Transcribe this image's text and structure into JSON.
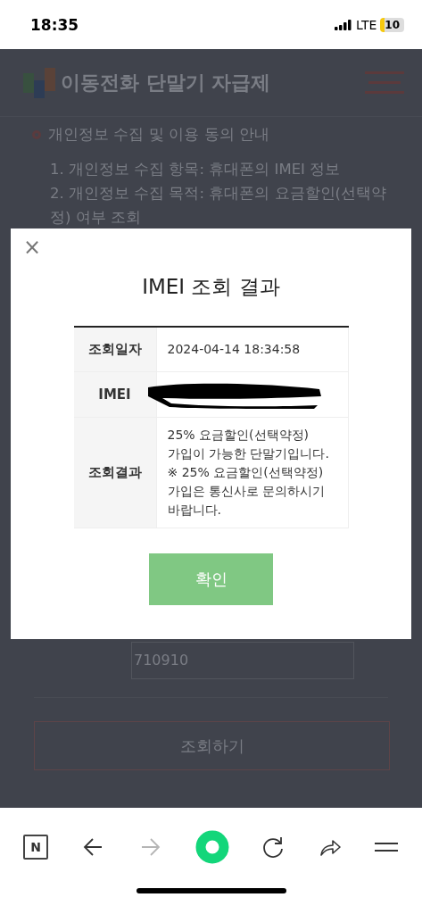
{
  "status_bar": {
    "time": "18:35",
    "network": "LTE",
    "battery": "10"
  },
  "page": {
    "site_title": "이동전화 단말기 자급제",
    "notice_heading": "개인정보 수집 및 이용 동의 안내",
    "notice_lines": [
      "1. 개인정보 수집 항목: 휴대폰의 IMEI 정보",
      "2. 개인정보 수집 목적: 휴대폰의 요금할인(선택약정) 여부 조회"
    ],
    "birth_field": {
      "value": "710910"
    },
    "submit_button": "조회하기"
  },
  "dialog": {
    "close": "×",
    "title": "IMEI 조회 결과",
    "rows": [
      {
        "kind": "text",
        "label": "조회일자",
        "value": "2024-04-14 18:34:58"
      },
      {
        "kind": "redacted",
        "label": "IMEI"
      },
      {
        "kind": "text",
        "label": "조회결과",
        "value": "25% 요금할인(선택약정) 가입이 가능한 단말기입니다. ※ 25% 요금할인(선택약정) 가입은 통신사로 문의하시기 바랍니다."
      }
    ],
    "confirm_button": "확인"
  },
  "browser_toolbar": {
    "home": "N",
    "items": [
      {
        "kind": "back",
        "disabled": false
      },
      {
        "kind": "forward",
        "disabled": true
      },
      {
        "kind": "green-dot",
        "disabled": false
      },
      {
        "kind": "reload",
        "disabled": false
      },
      {
        "kind": "share",
        "disabled": false
      },
      {
        "kind": "menu",
        "disabled": false
      }
    ]
  }
}
